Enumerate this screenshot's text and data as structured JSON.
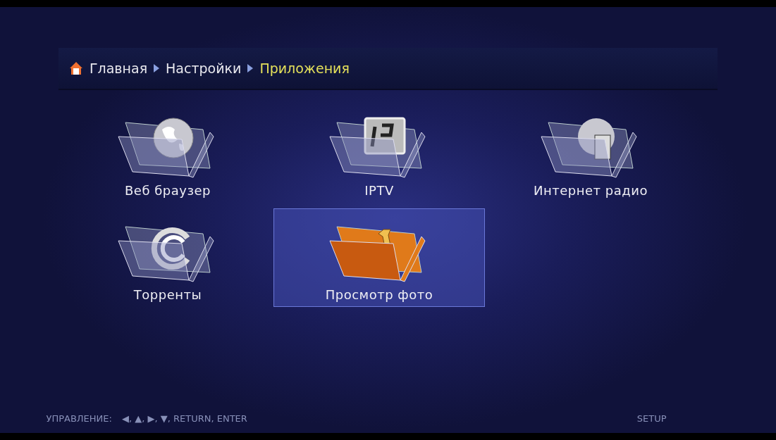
{
  "breadcrumb": [
    {
      "label": "Главная",
      "selected": false
    },
    {
      "label": "Настройки",
      "selected": false
    },
    {
      "label": "Приложения",
      "selected": true
    }
  ],
  "apps": [
    {
      "label": "Веб браузер",
      "kind": "globe",
      "selected": false
    },
    {
      "label": "IPTV",
      "kind": "iptv",
      "selected": false
    },
    {
      "label": "Интернет радио",
      "kind": "radio",
      "selected": false
    },
    {
      "label": "Торренты",
      "kind": "torrent",
      "selected": false
    },
    {
      "label": "Просмотр фото",
      "kind": "tools",
      "selected": true
    }
  ],
  "footer": {
    "controls_label": "УПРАВЛЕНИЕ:",
    "controls": "◀, ▲, ▶, ▼, RETURN, ENTER",
    "setup": "SETUP"
  }
}
